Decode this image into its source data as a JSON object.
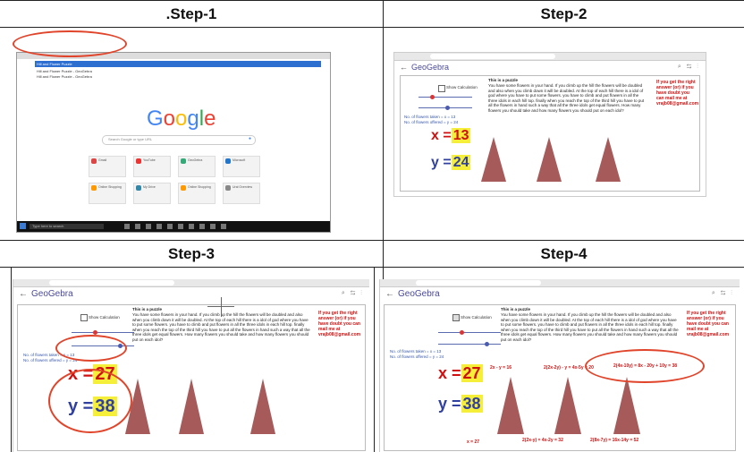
{
  "steps": [
    {
      "label": ".Step-1"
    },
    {
      "label": "Step-2"
    },
    {
      "label": "Step-3"
    },
    {
      "label": "Step-4"
    }
  ],
  "google": {
    "logo": "Google",
    "logo_colors": [
      "#4285f4",
      "#ea4335",
      "#fbbc05",
      "#4285f4",
      "#34a853",
      "#ea4335"
    ],
    "search_placeholder": "Search Google or type URL",
    "suggestions": [
      "Hill and Flower Puzzle",
      "Hill and Flower Puzzle - GeoGebra",
      "Hill and Flower Puzzle - GeoGebra"
    ],
    "tiles": [
      "Gmail",
      "YouTube",
      "GeoGebra",
      "Microsoft",
      "Online Shopping",
      "My Drive",
      "Online Shopping",
      "Ural Overview"
    ],
    "taskbar_search": "Type here to search"
  },
  "geogebra": {
    "app_name": "GeoGebra",
    "show_calculation": "Show Calculation",
    "puzzle_title": "This is a puzzle",
    "puzzle_text": "You have some flowers in your hand. If you climb up the hill the flowers will be doubled and also when you climb down it will be doubled. At the top of each hill there is a idol of god where you have to put some flowers. you have to climb and put flowers in all the three idols in each hill top. finally when you reach the top of the third hill you have to put all the flowers in hand such a way that all the three idols get equal flowers. How many flowers you should take and how many flowers you should put on each idol?",
    "hint": "If you get the right answer (or) if you have doubt you can mail me at vrajb08@gmail.com",
    "flowers_taken": "No. of flowers taken = x = 13",
    "flowers_offered": "No. of flowers offered = y = 24"
  },
  "panels": [
    {
      "x": "13",
      "y": "24"
    },
    {
      "x": "27",
      "y": "38"
    },
    {
      "x": "27",
      "y": "38"
    }
  ],
  "calc": {
    "c1": "2x - y = 16",
    "c2": "2(2x-2y) - y = 4x-5y = 20",
    "c3": "2(4x-10y) = 8x - 20y + 10y = 38",
    "b1": "x = 27",
    "b2": "2(2x-y) = 4x-2y = 32",
    "b3": "2(8x-7y) = 16x-14y = 52"
  }
}
